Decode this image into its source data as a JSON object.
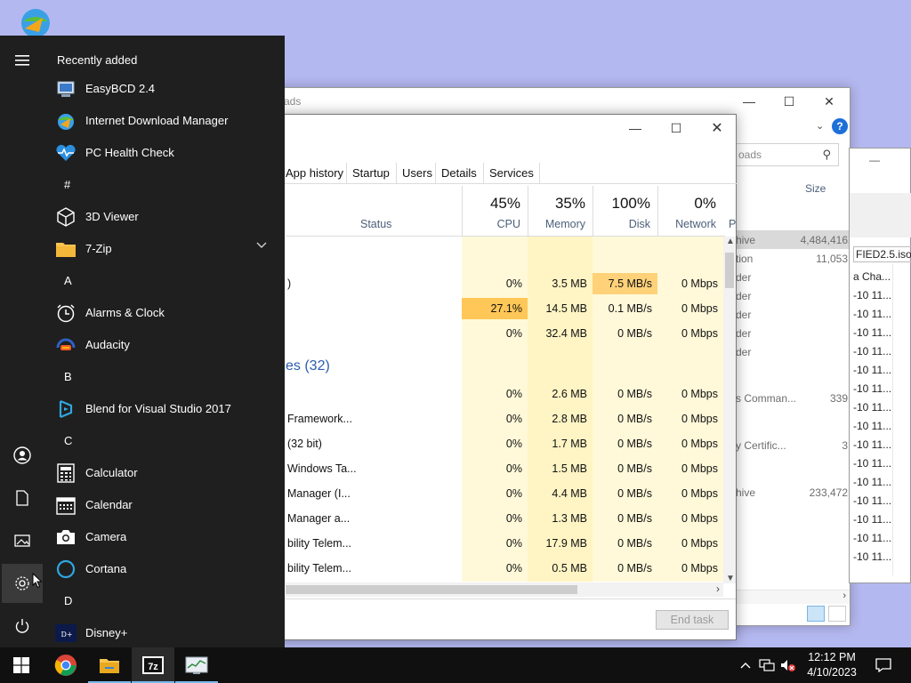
{
  "desktop": {
    "icon": "idm-desktop-icon"
  },
  "explorer": {
    "title_fragment": "ads",
    "search_placeholder_fragment": "oads",
    "size_header": "Size",
    "rows": [
      {
        "name": "hive",
        "size": "4,484,416",
        "selected": true
      },
      {
        "name": "tion",
        "size": "11,053"
      },
      {
        "name": "der",
        "size": ""
      },
      {
        "name": "der",
        "size": ""
      },
      {
        "name": "der",
        "size": ""
      },
      {
        "name": "der",
        "size": ""
      },
      {
        "name": "der",
        "size": ""
      },
      {
        "name": "s Comman...",
        "size": "339"
      },
      {
        "name": "y Certific...",
        "size": "3"
      },
      {
        "name": "hive",
        "size": "233,472"
      }
    ]
  },
  "third_window": {
    "header_row": "FIED2.5.iso",
    "rows": [
      "a Cha...",
      "-10 11...",
      "-10 11...",
      "-10 11...",
      "-10 11...",
      "-10 11...",
      "-10 11...",
      "-10 11...",
      "-10 11...",
      "-10 11...",
      "-10 11...",
      "-10 11...",
      "-10 11...",
      "-10 11...",
      "-10 11...",
      "-10 11..."
    ]
  },
  "task_manager": {
    "tabs": [
      "App history",
      "Startup",
      "Users",
      "Details",
      "Services"
    ],
    "status_header": "Status",
    "pe_header": "P",
    "columns": [
      {
        "pct": "45%",
        "label": "CPU"
      },
      {
        "pct": "35%",
        "label": "Memory"
      },
      {
        "pct": "100%",
        "label": "Disk"
      },
      {
        "pct": "0%",
        "label": "Network"
      }
    ],
    "group_label": "es (32)",
    "rows": [
      {
        "name": "",
        "cpu": "",
        "mem": "",
        "disk": "",
        "net": ""
      },
      {
        "name": ")",
        "cpu": "0%",
        "mem": "3.5 MB",
        "disk": "7.5 MB/s",
        "net": "0 Mbps"
      },
      {
        "name": "",
        "cpu": "27.1%",
        "mem": "14.5 MB",
        "disk": "0.1 MB/s",
        "net": "0 Mbps"
      },
      {
        "name": "",
        "cpu": "0%",
        "mem": "32.4 MB",
        "disk": "0 MB/s",
        "net": "0 Mbps"
      },
      {
        "name": "",
        "cpu": "0%",
        "mem": "2.6 MB",
        "disk": "0 MB/s",
        "net": "0 Mbps"
      },
      {
        "name": "Framework...",
        "cpu": "0%",
        "mem": "2.8 MB",
        "disk": "0 MB/s",
        "net": "0 Mbps"
      },
      {
        "name": "(32 bit)",
        "cpu": "0%",
        "mem": "1.7 MB",
        "disk": "0 MB/s",
        "net": "0 Mbps"
      },
      {
        "name": "Windows Ta...",
        "cpu": "0%",
        "mem": "1.5 MB",
        "disk": "0 MB/s",
        "net": "0 Mbps"
      },
      {
        "name": "Manager (I...",
        "cpu": "0%",
        "mem": "4.4 MB",
        "disk": "0 MB/s",
        "net": "0 Mbps"
      },
      {
        "name": "Manager a...",
        "cpu": "0%",
        "mem": "1.3 MB",
        "disk": "0 MB/s",
        "net": "0 Mbps"
      },
      {
        "name": "bility Telem...",
        "cpu": "0%",
        "mem": "17.9 MB",
        "disk": "0 MB/s",
        "net": "0 Mbps"
      },
      {
        "name": "bility Telem...",
        "cpu": "0%",
        "mem": "0.5 MB",
        "disk": "0 MB/s",
        "net": "0 Mbps"
      }
    ],
    "end_task_label": "End task"
  },
  "start_menu": {
    "recently_added_label": "Recently added",
    "items": [
      {
        "type": "app",
        "label": "EasyBCD 2.4",
        "icon": "easybcd-icon"
      },
      {
        "type": "app",
        "label": "Internet Download Manager",
        "icon": "idm-icon"
      },
      {
        "type": "app",
        "label": "PC Health Check",
        "icon": "health-icon"
      },
      {
        "type": "letter",
        "label": "#"
      },
      {
        "type": "app",
        "label": "3D Viewer",
        "icon": "cube-icon"
      },
      {
        "type": "app",
        "label": "7-Zip",
        "icon": "folder-icon",
        "expandable": true
      },
      {
        "type": "letter",
        "label": "A"
      },
      {
        "type": "app",
        "label": "Alarms & Clock",
        "icon": "clock-icon"
      },
      {
        "type": "app",
        "label": "Audacity",
        "icon": "audacity-icon"
      },
      {
        "type": "letter",
        "label": "B"
      },
      {
        "type": "app",
        "label": "Blend for Visual Studio 2017",
        "icon": "blend-icon"
      },
      {
        "type": "letter",
        "label": "C"
      },
      {
        "type": "app",
        "label": "Calculator",
        "icon": "calculator-icon"
      },
      {
        "type": "app",
        "label": "Calendar",
        "icon": "calendar-icon"
      },
      {
        "type": "app",
        "label": "Camera",
        "icon": "camera-icon"
      },
      {
        "type": "app",
        "label": "Cortana",
        "icon": "cortana-icon"
      },
      {
        "type": "letter",
        "label": "D"
      },
      {
        "type": "app",
        "label": "Disney+",
        "icon": "disney-icon"
      }
    ]
  },
  "taskbar": {
    "clock_time": "12:12 PM",
    "clock_date": "4/10/2023"
  }
}
